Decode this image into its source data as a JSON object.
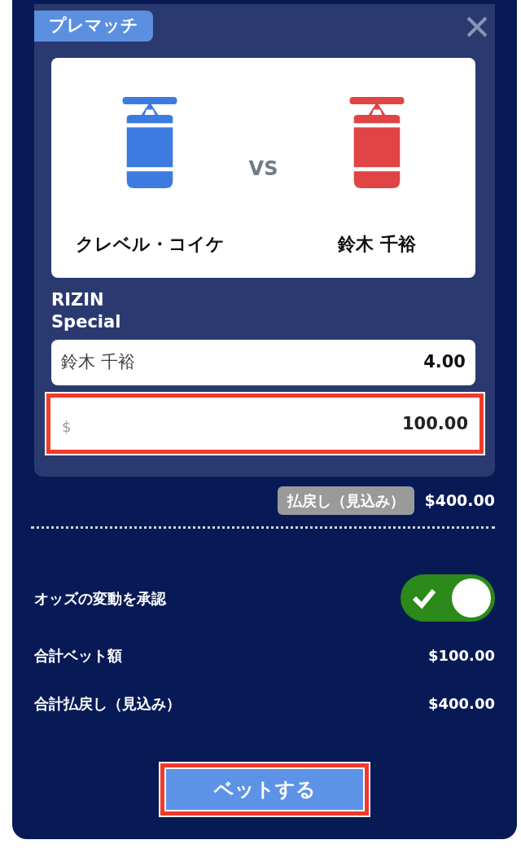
{
  "badge": "プレマッチ",
  "match": {
    "fighters": [
      {
        "name": "クレベル・コイケ",
        "color": "#3d7be0"
      },
      {
        "name": "鈴木 千裕",
        "color": "#e04444"
      }
    ],
    "versus": "VS"
  },
  "market": "RIZIN Special",
  "selection": {
    "name": "鈴木 千裕",
    "odds": "4.00"
  },
  "stake": {
    "prefix": "$",
    "value": "100.00",
    "highlighted": true
  },
  "payout": {
    "label": "払戻し（見込み）",
    "value": "$400.00"
  },
  "accept_odds": {
    "label": "オッズの変動を承認",
    "on": true
  },
  "totals": [
    {
      "label": "合計ベット額",
      "value": "$100.00"
    },
    {
      "label": "合計払戻し（見込み）",
      "value": "$400.00"
    }
  ],
  "bet_button": {
    "label": "ベットする",
    "highlighted": true
  }
}
